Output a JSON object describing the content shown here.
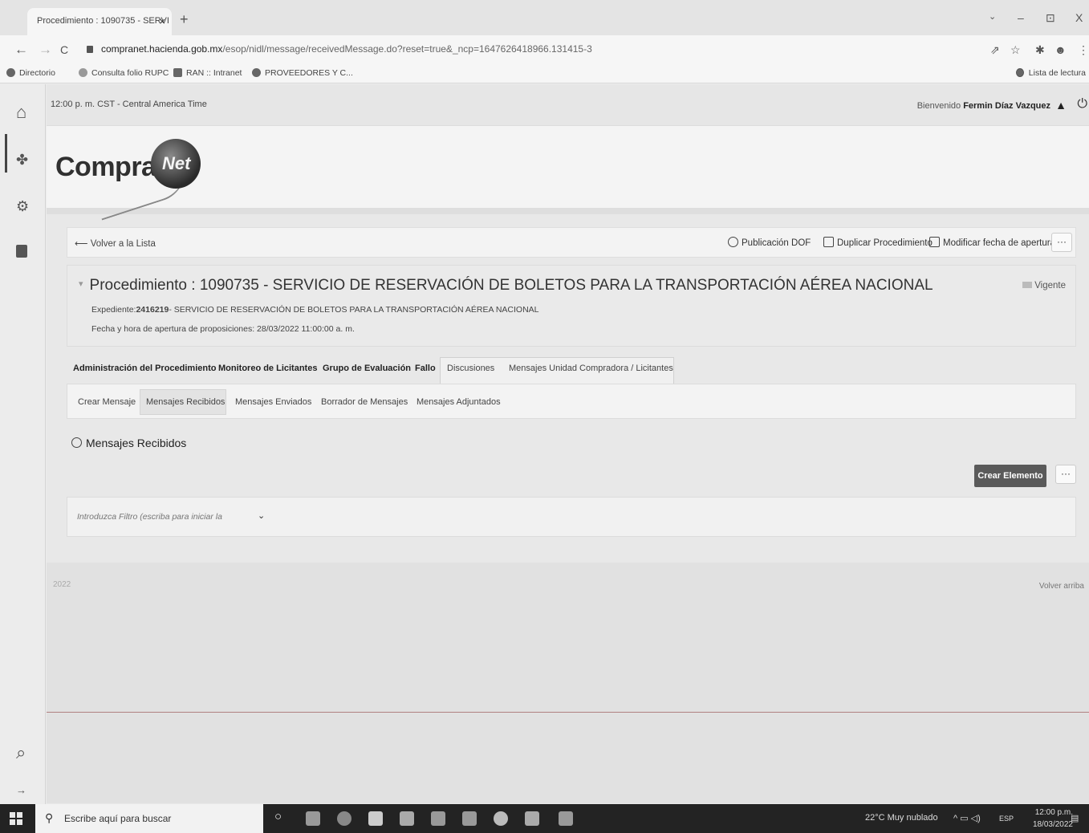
{
  "browser": {
    "tab_title": "Procedimiento : 1090735 - SERVI",
    "tab_close": "×",
    "new_tab": "+",
    "url_host": "compranet.hacienda.gob.mx",
    "url_path": "/esop/nidl/message/receivedMessage.do?reset=true&_ncp=1647626418966.131415-3",
    "bookmarks": [
      "Directorio",
      "Consulta folio RUPC",
      "RAN :: Intranet",
      "PROVEEDORES Y C..."
    ],
    "reading_list": "Lista de lectura"
  },
  "icons": {
    "back": "←",
    "forward": "→",
    "reload": "C",
    "minimize": "–",
    "restore": "⊡",
    "close": "X",
    "share": "⇗",
    "star": "☆",
    "extension": "✱",
    "profile": "☻",
    "menu": "⋮",
    "home": "⌂",
    "sidebar2": "✤",
    "sidebar3": "⚙",
    "search": "⌕",
    "collapse": "→",
    "user": "▲",
    "power": "⏻",
    "arrow_left": "⟵",
    "chevron_down": "⌄"
  },
  "header": {
    "time": "12:00 p. m. CST - Central America Time",
    "welcome_prefix": "Bienvenido ",
    "user_name": "Fermin Díaz Vazquez"
  },
  "logo": {
    "compra": "Compra",
    "net": "Net"
  },
  "actions": {
    "back_to_list": "Volver a la Lista",
    "publicacion": "Publicación DOF",
    "duplicar": "Duplicar Procedimiento",
    "modificar": "Modificar fecha de apertura",
    "more": "···"
  },
  "procedure": {
    "title": "Procedimiento : 1090735 - SERVICIO DE RESERVACIÓN DE BOLETOS PARA LA TRANSPORTACIÓN AÉREA NACIONAL",
    "status": "Vigente",
    "expediente_label": "Expediente:",
    "expediente_num": "2416219",
    "expediente_desc": "- SERVICIO DE RESERVACIÓN DE BOLETOS PARA LA TRANSPORTACIÓN AÉREA NACIONAL",
    "apertura": "Fecha y hora de apertura de proposiciones: 28/03/2022 11:00:00 a. m."
  },
  "main_tabs": [
    "Administración del Procedimiento",
    "Monitoreo de Licitantes",
    "Grupo de Evaluación",
    "Fallo",
    "Discusiones",
    "Mensajes Unidad Compradora / Licitantes"
  ],
  "sub_tabs": [
    "Crear Mensaje",
    "Mensajes Recibidos",
    "Mensajes Enviados",
    "Borrador de Mensajes",
    "Mensajes Adjuntados"
  ],
  "section": {
    "title": "Mensajes Recibidos",
    "create_button": "Crear Elemento",
    "more": "···",
    "filter_placeholder": "Introduzca Filtro (escriba para iniciar la"
  },
  "footer": {
    "year": "2022",
    "back_to_top": "Volver arriba"
  },
  "taskbar": {
    "search_placeholder": "Escribe aquí para buscar",
    "weather": "22°C  Muy nublado",
    "lang": "ESP",
    "time": "12:00 p.m.",
    "date": "18/03/2022"
  }
}
